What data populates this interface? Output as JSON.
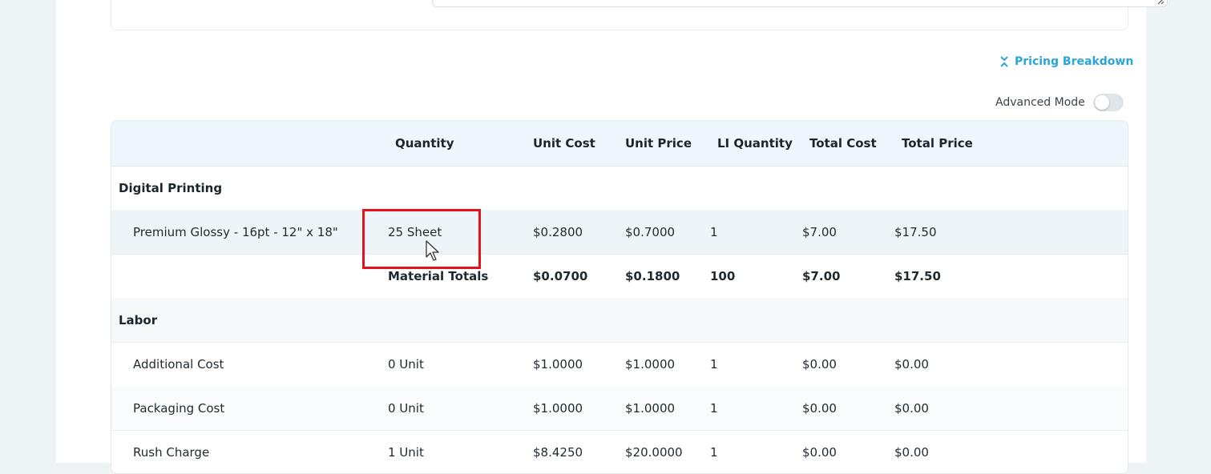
{
  "pricing_breakdown": {
    "label": "Pricing Breakdown",
    "icon": "collapse-icon"
  },
  "advanced_mode": {
    "label": "Advanced Mode",
    "enabled": false
  },
  "table": {
    "headers": [
      "",
      "Quantity",
      "Unit Cost",
      "Unit Price",
      "LI Quantity",
      "Total Cost",
      "Total Price"
    ],
    "groups": {
      "digital_printing": {
        "label": "Digital Printing",
        "item": {
          "name": "Premium Glossy - 16pt - 12\" x 18\"",
          "quantity": "25 Sheet",
          "unit_cost": "$0.2800",
          "unit_price": "$0.7000",
          "li_quantity": "1",
          "total_cost": "$7.00",
          "total_price": "$17.50"
        },
        "totals": {
          "label": "Material Totals",
          "unit_cost": "$0.0700",
          "unit_price": "$0.1800",
          "li_quantity": "100",
          "total_cost": "$7.00",
          "total_price": "$17.50"
        }
      },
      "labor": {
        "label": "Labor",
        "items": [
          {
            "name": "Additional Cost",
            "quantity": "0 Unit",
            "unit_cost": "$1.0000",
            "unit_price": "$1.0000",
            "li_quantity": "1",
            "total_cost": "$0.00",
            "total_price": "$0.00"
          },
          {
            "name": "Packaging Cost",
            "quantity": "0 Unit",
            "unit_cost": "$1.0000",
            "unit_price": "$1.0000",
            "li_quantity": "1",
            "total_cost": "$0.00",
            "total_price": "$0.00"
          },
          {
            "name": "Rush Charge",
            "quantity": "1 Unit",
            "unit_cost": "$8.4250",
            "unit_price": "$20.0000",
            "li_quantity": "1",
            "total_cost": "$0.00",
            "total_price": "$0.00"
          }
        ]
      }
    }
  },
  "colors": {
    "accent": "#2aa6d6",
    "highlight": "#e3131b",
    "header_bg": "#eef8fc",
    "selected_row_bg": "#eef5f8"
  }
}
